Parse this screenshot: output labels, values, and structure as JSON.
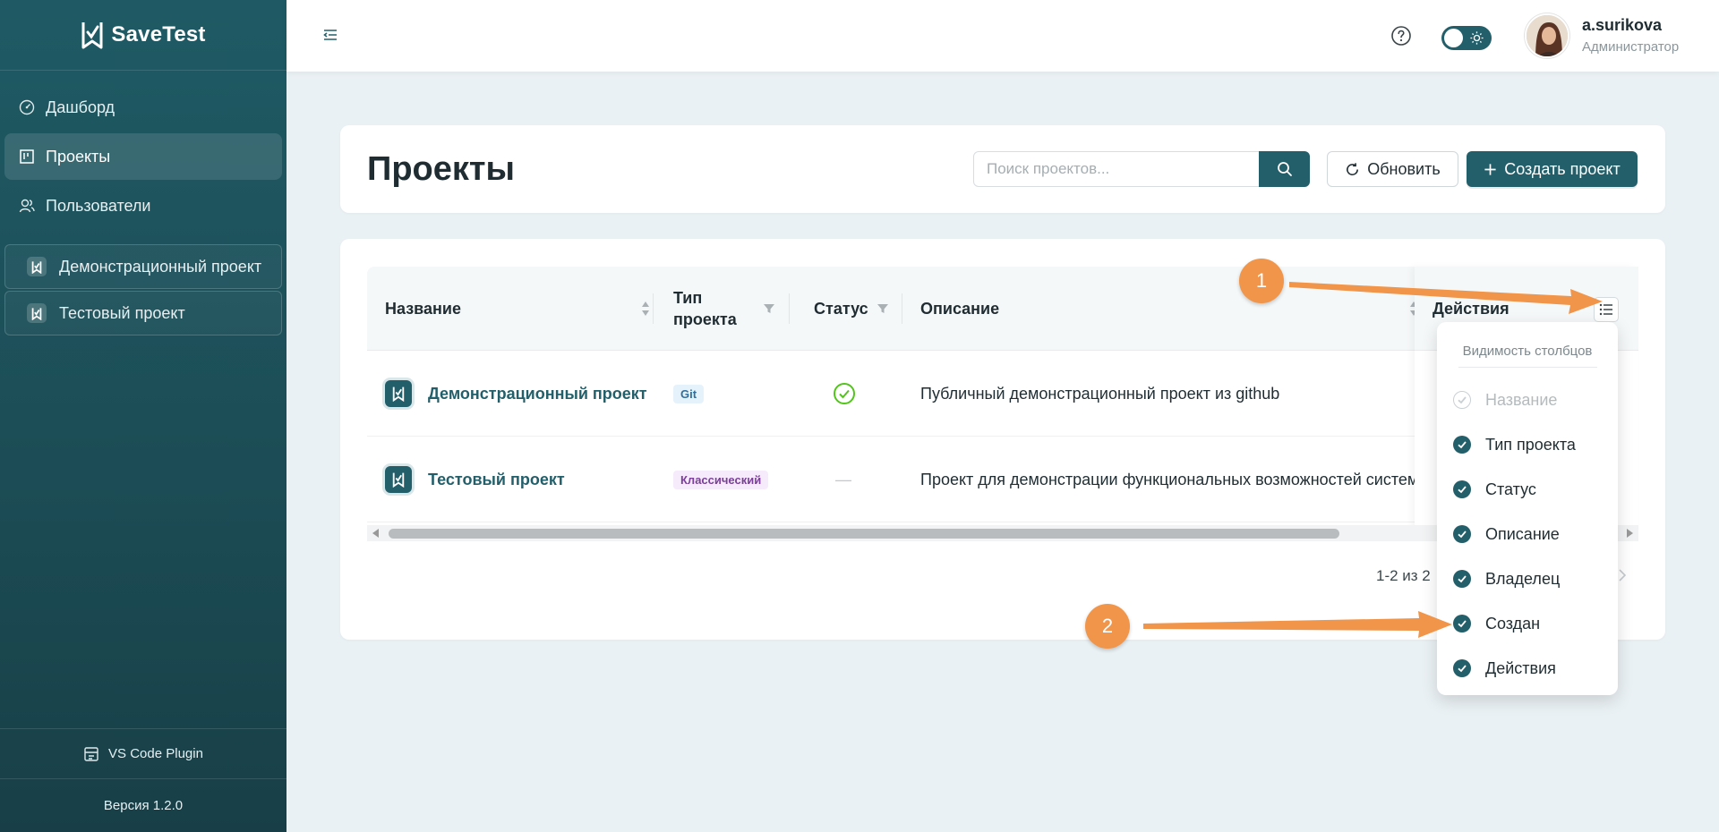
{
  "app": {
    "logo_text": "SaveTest"
  },
  "sidebar": {
    "items": [
      {
        "label": "Дашборд",
        "icon": "dashboard-icon"
      },
      {
        "label": "Проекты",
        "icon": "board-icon",
        "active": true
      },
      {
        "label": "Пользователи",
        "icon": "users-icon"
      }
    ],
    "projects": [
      {
        "label": "Демонстрационный проект"
      },
      {
        "label": "Тестовый проект"
      }
    ],
    "plugin_label": "VS Code Plugin",
    "version": "Версия 1.2.0"
  },
  "header": {
    "user_name": "a.surikova",
    "user_role": "Администратор",
    "theme_toggle": "light"
  },
  "page": {
    "title": "Проекты",
    "search_placeholder": "Поиск проектов...",
    "refresh_label": "Обновить",
    "create_label": "Создать проект"
  },
  "table": {
    "columns": {
      "name": "Название",
      "type_line1": "Тип",
      "type_line2": "проекта",
      "status": "Статус",
      "description": "Описание",
      "actions": "Действия"
    },
    "rows": [
      {
        "name": "Демонстрационный проект",
        "type": "Git",
        "status": "active",
        "description": "Публичный демонстрационный проект из github"
      },
      {
        "name": "Тестовый проект",
        "type": "Классический",
        "status": "—",
        "description": "Проект для демонстрации функциональных возможностей системы"
      }
    ],
    "pagination": "1-2 из 2"
  },
  "column_visibility": {
    "title": "Видимость столбцов",
    "options": [
      {
        "label": "Название",
        "checked": true,
        "disabled": true
      },
      {
        "label": "Тип проекта",
        "checked": true
      },
      {
        "label": "Статус",
        "checked": true
      },
      {
        "label": "Описание",
        "checked": true
      },
      {
        "label": "Владелец",
        "checked": true
      },
      {
        "label": "Создан",
        "checked": true
      },
      {
        "label": "Действия",
        "checked": true
      }
    ]
  },
  "annotations": [
    {
      "number": "1"
    },
    {
      "number": "2"
    }
  ],
  "colors": {
    "primary": "#235f6a",
    "accent": "#f0954a",
    "success": "#52c41a"
  }
}
